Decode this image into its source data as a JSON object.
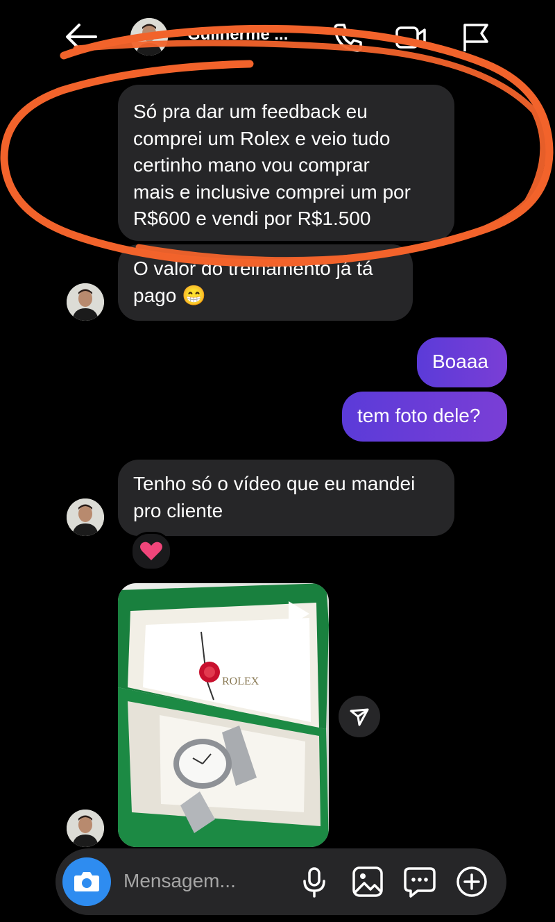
{
  "header": {
    "contact_name": "Guilherme ...",
    "icons": [
      "back-arrow-icon",
      "phone-icon",
      "video-camera-icon",
      "flag-icon"
    ]
  },
  "messages": [
    {
      "direction": "in",
      "lines": [
        "Só pra dar um feedback eu",
        "comprei um Rolex e veio tudo",
        "certinho mano vou comprar",
        "mais e inclusive comprei um por",
        "R$600 e vendi por R$1.500"
      ]
    },
    {
      "direction": "in",
      "lines": [
        "O valor do treinamento já tá",
        "pago 😁"
      ]
    },
    {
      "direction": "out",
      "lines": [
        "Boaaa"
      ]
    },
    {
      "direction": "out",
      "lines": [
        "tem foto dele?"
      ]
    },
    {
      "direction": "in",
      "lines": [
        "Tenho só o vídeo que eu mandei",
        "pro cliente"
      ],
      "reaction": "❤️"
    }
  ],
  "media": {
    "type": "video",
    "box_label": "ROLEX",
    "icons": [
      "play-icon",
      "share-icon"
    ]
  },
  "composer": {
    "placeholder": "Mensagem...",
    "icons": [
      "camera-icon",
      "microphone-icon",
      "gallery-icon",
      "sticker-icon",
      "plus-icon"
    ]
  },
  "colors": {
    "background": "#000000",
    "incoming_bubble": "#262628",
    "outgoing_bubble": "#6a3fd6",
    "camera_button": "#2e8cf0",
    "annotation_stroke": "#f2632b"
  }
}
